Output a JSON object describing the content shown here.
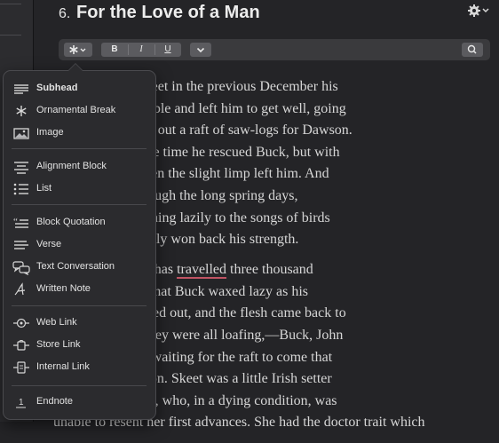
{
  "header": {
    "chapter_number": "6.",
    "chapter_title": "For the Love of a Man"
  },
  "toolbar": {
    "bold_label": "B",
    "italic_label": "I",
    "underline_label": "U"
  },
  "document": {
    "paragraphs": [
      {
        "lines": [
          "ornton froze his feet in the previous December his",
          "ade him comfortable and left him to get well, going",
          "up the river to get out a raft of saw-logs for Dawson.",
          "ping slightly at the time he rescued Buck, but with",
          "warm weather even the slight limp left him. And",
          "he river bank through the long spring days,",
          "nning water, listening lazily to the songs of birds",
          "nature, Buck slowly won back his strength."
        ]
      },
      {
        "lines": [
          "ry good after one has ",
          "ust be confessed that Buck waxed lazy as his",
          " his muscles swelled out, and the flesh came back to",
          " For that matter, they were all loafing,—Buck, John",
          "Skeet and Nig,—waiting for the raft to come that",
          "m down to Dawson. Skeet was a little Irish setter",
          " friends with Buck, who, in a dying condition, was",
          "unable to resent her first advances. She had the doctor trait which"
        ],
        "misspelled_word": "travelled",
        "after_misspelled": " three thousand"
      }
    ]
  },
  "style_menu": {
    "items": [
      {
        "label": "Subhead",
        "icon": "subhead-icon"
      },
      {
        "label": "Ornamental Break",
        "icon": "asterisk-icon"
      },
      {
        "label": "Image",
        "icon": "image-icon"
      },
      {
        "label": "Alignment Block",
        "icon": "alignment-icon"
      },
      {
        "label": "List",
        "icon": "list-icon"
      },
      {
        "label": "Block Quotation",
        "icon": "quote-icon"
      },
      {
        "label": "Verse",
        "icon": "verse-icon"
      },
      {
        "label": "Text Conversation",
        "icon": "chat-bubbles-icon"
      },
      {
        "label": "Written Note",
        "icon": "script-a-icon"
      },
      {
        "label": "Web Link",
        "icon": "web-link-icon"
      },
      {
        "label": "Store Link",
        "icon": "store-link-icon"
      },
      {
        "label": "Internal Link",
        "icon": "internal-link-icon"
      },
      {
        "label": "Endnote",
        "icon": "endnote-icon"
      }
    ],
    "endnote_glyph": "1"
  },
  "colors": {
    "background": "#242427",
    "text": "#d6d6d6",
    "menu_background": "#2b2b2e",
    "spellcheck_underline": "#c05464"
  }
}
